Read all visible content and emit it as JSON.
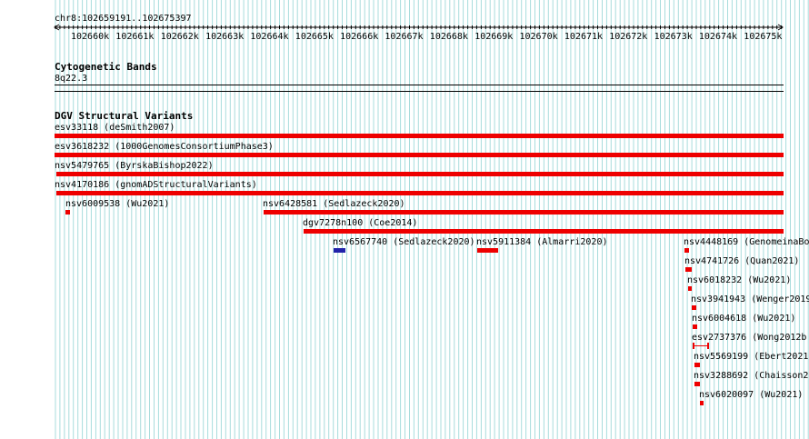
{
  "ruler": {
    "location": "chr8:102659191..102675397",
    "ticks": [
      "102660k",
      "102661k",
      "102662k",
      "102663k",
      "102664k",
      "102665k",
      "102666k",
      "102667k",
      "102668k",
      "102669k",
      "102670k",
      "102671k",
      "102672k",
      "102673k",
      "102674k",
      "102675k"
    ]
  },
  "cytobands": {
    "title": "Cytogenetic Bands",
    "band": "8q22.3"
  },
  "dgv": {
    "title": "DGV Structural Variants",
    "features": [
      {
        "label": "esv33118 (deSmith2007)",
        "color": "#ee0000"
      },
      {
        "label": "esv3618232 (1000GenomesConsortiumPhase3)",
        "color": "#ee0000"
      },
      {
        "label": "nsv5479765 (ByrskaBishop2022)",
        "color": "#ee0000"
      },
      {
        "label": "nsv4170186 (gnomADStructuralVariants)",
        "color": "#ee0000"
      },
      {
        "label": "nsv6009538 (Wu2021)",
        "color": "#ee0000"
      },
      {
        "label": "nsv6428581 (Sedlazeck2020)",
        "color": "#ee0000"
      },
      {
        "label": "dgv7278n100 (Coe2014)",
        "color": "#ee0000"
      },
      {
        "label": "nsv6567740 (Sedlazeck2020)",
        "color": "#2222aa"
      },
      {
        "label": "nsv5911384 (Almarri2020)",
        "color": "#ee0000"
      },
      {
        "label": "nsv4448169 (GenomeinaBo",
        "color": "#ee0000"
      },
      {
        "label": "nsv4741726 (Quan2021)",
        "color": "#ee0000"
      },
      {
        "label": "nsv6018232 (Wu2021)",
        "color": "#ee0000"
      },
      {
        "label": "nsv3941943 (Wenger2019",
        "color": "#ee0000"
      },
      {
        "label": "nsv6004618 (Wu2021)",
        "color": "#ee0000"
      },
      {
        "label": "esv2737376 (Wong2012b",
        "color": "#ee0000"
      },
      {
        "label": "nsv5569199 (Ebert2021",
        "color": "#ee0000"
      },
      {
        "label": "nsv3288692 (Chaisson2",
        "color": "#ee0000"
      },
      {
        "label": "nsv6020097 (Wu2021)",
        "color": "#ee0000"
      }
    ]
  }
}
